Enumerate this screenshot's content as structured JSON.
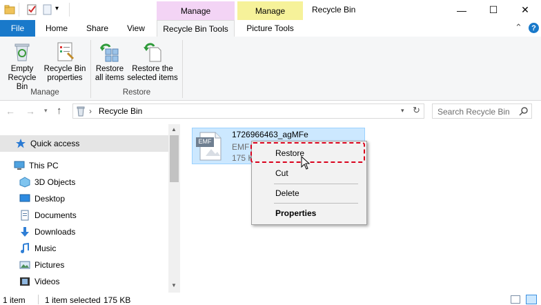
{
  "window": {
    "title": "Recycle Bin",
    "minimize_glyph": "—",
    "maximize_glyph": "☐",
    "close_glyph": "✕"
  },
  "quick_access_toolbar": {
    "dropdown_glyph": "▾"
  },
  "contextual_tabs": [
    {
      "label": "Manage",
      "color": "#f3d4f5"
    },
    {
      "label": "Manage",
      "color": "#f6f29a"
    }
  ],
  "ribbon_tabs": {
    "file": "File",
    "home": "Home",
    "share": "Share",
    "view": "View",
    "recycle_bin_tools": "Recycle Bin Tools",
    "picture_tools": "Picture Tools"
  },
  "ribbon": {
    "manage_group": {
      "label": "Manage",
      "buttons": [
        {
          "line1": "Empty",
          "line2": "Recycle Bin",
          "icon": "recycle-bin-icon"
        },
        {
          "line1": "Recycle Bin",
          "line2": "properties",
          "icon": "properties-icon"
        }
      ]
    },
    "restore_group": {
      "label": "Restore",
      "buttons": [
        {
          "line1": "Restore",
          "line2": "all items",
          "icon": "restore-all-icon"
        },
        {
          "line1": "Restore the",
          "line2": "selected items",
          "icon": "restore-selected-icon"
        }
      ]
    },
    "collapse_glyph": "⌃",
    "help_glyph": "?"
  },
  "address_bar": {
    "location": "Recycle Bin",
    "separator": "›",
    "search_placeholder": "Search Recycle Bin"
  },
  "nav_pane": {
    "quick_access": "Quick access",
    "this_pc": "This PC",
    "items": [
      "3D Objects",
      "Desktop",
      "Documents",
      "Downloads",
      "Music",
      "Pictures",
      "Videos"
    ]
  },
  "file": {
    "name": "1726966463_agMFe",
    "type": "EMF",
    "size": "175 K",
    "thumb_label": "EMF"
  },
  "context_menu": {
    "restore": "Restore",
    "cut": "Cut",
    "delete": "Delete",
    "properties": "Properties"
  },
  "status_bar": {
    "count": "1 item",
    "selected": "1 item selected",
    "selected_size": "175 KB"
  },
  "colors": {
    "accent": "#1979ca",
    "selection": "#cce8ff",
    "highlight_border": "#d9001b"
  }
}
